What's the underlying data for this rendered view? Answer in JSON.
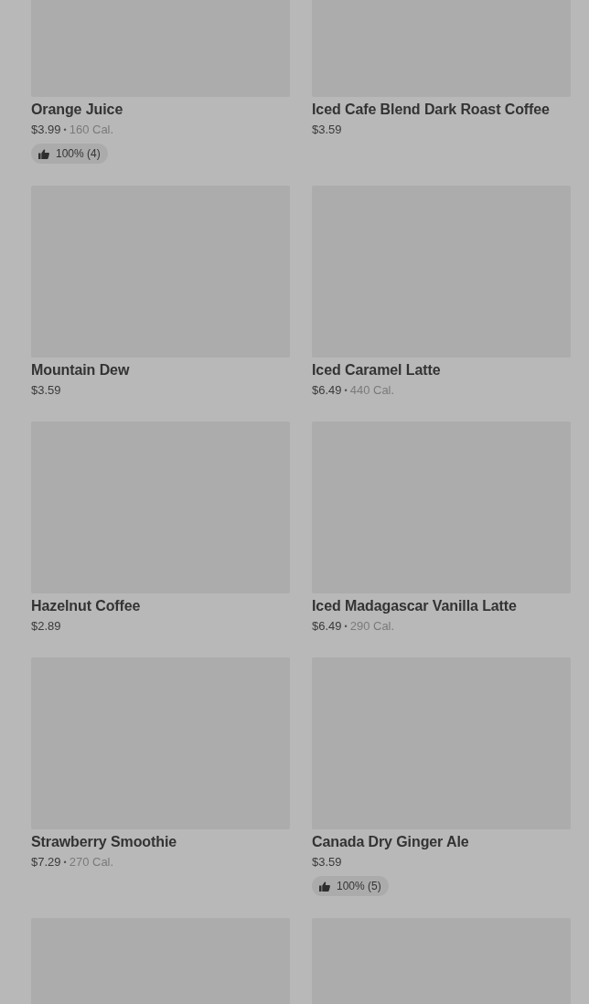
{
  "separator": "•",
  "items": [
    {
      "kind": "product",
      "name": "Orange Juice",
      "price": "$3.99",
      "calories": "160 Cal.",
      "rating": "100% (4)"
    },
    {
      "kind": "product",
      "name": "Iced Cafe Blend Dark Roast Coffee",
      "price": "$3.59"
    },
    {
      "kind": "product",
      "name": "Mountain Dew",
      "price": "$3.59"
    },
    {
      "kind": "product",
      "name": "Iced Caramel Latte",
      "price": "$6.49",
      "calories": "440 Cal."
    },
    {
      "kind": "product",
      "name": "Hazelnut Coffee",
      "price": "$2.89"
    },
    {
      "kind": "product",
      "name": "Iced Madagascar Vanilla Latte",
      "price": "$6.49",
      "calories": "290 Cal."
    },
    {
      "kind": "product",
      "name": "Strawberry Smoothie",
      "price": "$7.29",
      "calories": "270 Cal."
    },
    {
      "kind": "product",
      "name": "Canada Dry Ginger Ale",
      "price": "$3.59",
      "rating": "100% (5)"
    },
    {
      "kind": "image-only"
    },
    {
      "kind": "image-only"
    }
  ]
}
